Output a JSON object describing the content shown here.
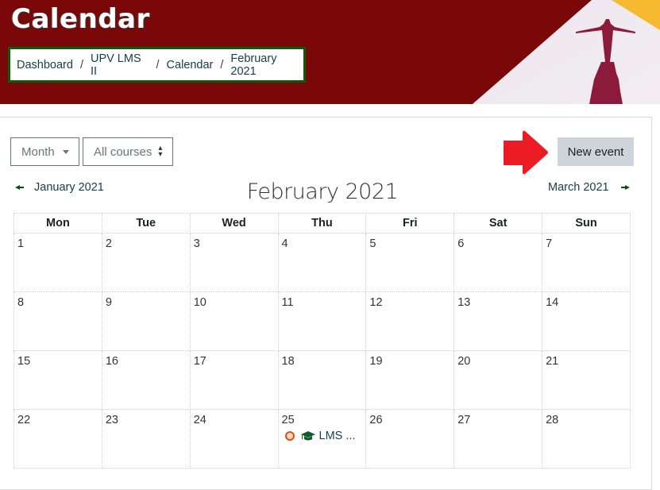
{
  "header": {
    "title": "Calendar",
    "breadcrumb": [
      "Dashboard",
      "UPV LMS II",
      "Calendar",
      "February 2021"
    ],
    "brand_color": "#7b0808"
  },
  "controls": {
    "view_select": "Month",
    "course_select": "All courses",
    "new_event_label": "New event"
  },
  "navigation": {
    "prev_month": "January 2021",
    "current_month": "February 2021",
    "next_month": "March 2021"
  },
  "calendar": {
    "weekdays": [
      "Mon",
      "Tue",
      "Wed",
      "Thu",
      "Fri",
      "Sat",
      "Sun"
    ],
    "weeks": [
      [
        "1",
        "2",
        "3",
        "4",
        "5",
        "6",
        "7"
      ],
      [
        "8",
        "9",
        "10",
        "11",
        "12",
        "13",
        "14"
      ],
      [
        "15",
        "16",
        "17",
        "18",
        "19",
        "20",
        "21"
      ],
      [
        "22",
        "23",
        "24",
        "25",
        "26",
        "27",
        "28"
      ]
    ],
    "events": [
      {
        "day": "25",
        "label": "LMS ...",
        "type": "course-event"
      }
    ]
  }
}
